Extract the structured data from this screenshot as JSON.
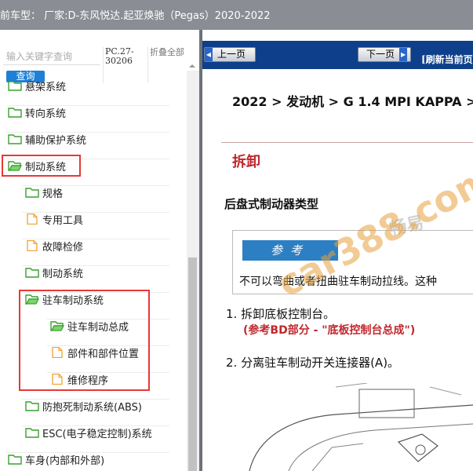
{
  "titlebar": {
    "text": "前车型： 厂家:D-东风悦达.起亚焕驰（Pegas）2020-2022"
  },
  "search": {
    "placeholder": "输入关键字查询",
    "button_label": "查询",
    "pc_code": "PC.27-30206",
    "fold_label": "折叠全部"
  },
  "tree": {
    "items": [
      {
        "label": "悬架系统",
        "icon": "folder-icon"
      },
      {
        "label": "转向系统",
        "icon": "folder-icon"
      },
      {
        "label": "辅助保护系统",
        "icon": "folder-icon"
      },
      {
        "label": "制动系统",
        "icon": "folder-open-icon"
      },
      {
        "label": "规格",
        "icon": "folder-icon"
      },
      {
        "label": "专用工具",
        "icon": "document-icon"
      },
      {
        "label": "故障检修",
        "icon": "document-icon"
      },
      {
        "label": "制动系统",
        "icon": "folder-icon"
      },
      {
        "label": "驻车制动系统",
        "icon": "folder-open-icon"
      },
      {
        "label": "驻车制动总成",
        "icon": "folder-open-icon"
      },
      {
        "label": "部件和部件位置",
        "icon": "document-icon"
      },
      {
        "label": "维修程序",
        "icon": "document-icon"
      },
      {
        "label": "防抱死制动系统(ABS)",
        "icon": "folder-icon"
      },
      {
        "label": "ESC(电子稳定控制)系统",
        "icon": "folder-icon"
      },
      {
        "label": "车身(内部和外部)",
        "icon": "folder-icon"
      }
    ]
  },
  "nav": {
    "prev_label": "上一页",
    "next_label": "下一页",
    "refresh_label": "[刷新当前页"
  },
  "doc": {
    "breadcrumb": "2022 > 发动机 > G 1.4 MPI KAPPA >",
    "section_title": "拆卸",
    "subtitle": "后盘式制动器类型",
    "note_header": "参考",
    "note_text": "不可以弯曲或者扭曲驻车制动拉线。这种",
    "step1": "1.  拆卸底板控制台。",
    "step1_ref": "(参考BD部分 - \"底板控制台总成\")",
    "step2": "2.  分离驻车制动开关连接器(A)。"
  },
  "watermark": {
    "brand": "畅易",
    "url": "car388.com"
  },
  "colors": {
    "highlight": "#e53935",
    "nav_bar": "#0e3f8a",
    "accent_red": "#c0272d",
    "note_blue": "#2d7fc3",
    "folder_green": "#3aa12f",
    "doc_orange": "#f0a030"
  }
}
